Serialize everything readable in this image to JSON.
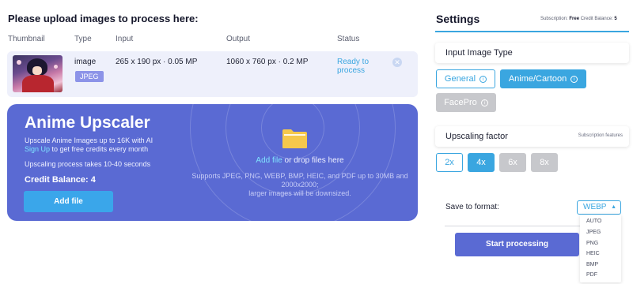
{
  "page_title": "Please upload images to process here:",
  "table": {
    "headers": {
      "thumbnail": "Thumbnail",
      "type": "Type",
      "input": "Input",
      "output": "Output",
      "status": "Status"
    },
    "rows": [
      {
        "type": "image",
        "format": "JPEG",
        "input": "265 x 190 px · 0.05 MP",
        "output": "1060 x 760 px · 0.2 MP",
        "status": "Ready to process",
        "remove_icon": "close-icon"
      }
    ]
  },
  "upload_panel": {
    "title": "Anime Upscaler",
    "line1": "Upscale Anime Images up to 16K with AI",
    "signup_link": "Sign Up",
    "line2_rest": " to get free credits every month",
    "line3": "Upscaling process takes 10-40 seconds",
    "credit_balance": "Credit Balance: 4",
    "add_file_button": "Add file",
    "drop_link": "Add file",
    "drop_rest": " or drop files here",
    "supports_line1": "Supports JPEG, PNG, WEBP, BMP, HEIC, and PDF up to 30MB and 2000x2000;",
    "supports_line2": "larger images will be downsized.",
    "folder_icon": "folder-icon",
    "folder_color": "#f5c84c",
    "accent": "#5a6ad3"
  },
  "settings": {
    "title": "Settings",
    "subscription_label": "Subscription:",
    "subscription_value": "Free",
    "credit_label": "Credit Balance:",
    "credit_value": "5",
    "input_type": {
      "label": "Input Image Type",
      "options": [
        {
          "label": "General",
          "state": "outline"
        },
        {
          "label": "Anime/Cartoon",
          "state": "active"
        },
        {
          "label": "FacePro",
          "state": "disabled"
        }
      ]
    },
    "upscaling": {
      "label": "Upscaling factor",
      "note": "Subscription features",
      "options": [
        {
          "label": "2x",
          "state": "outline"
        },
        {
          "label": "4x",
          "state": "active"
        },
        {
          "label": "6x",
          "state": "disabled"
        },
        {
          "label": "8x",
          "state": "disabled"
        }
      ]
    },
    "save_format": {
      "label": "Save to format:",
      "selected": "WEBP",
      "options": [
        "AUTO",
        "JPEG",
        "PNG",
        "HEIC",
        "BMP",
        "PDF"
      ]
    },
    "start_button": "Start processing",
    "accent": "#3aa6e0"
  }
}
